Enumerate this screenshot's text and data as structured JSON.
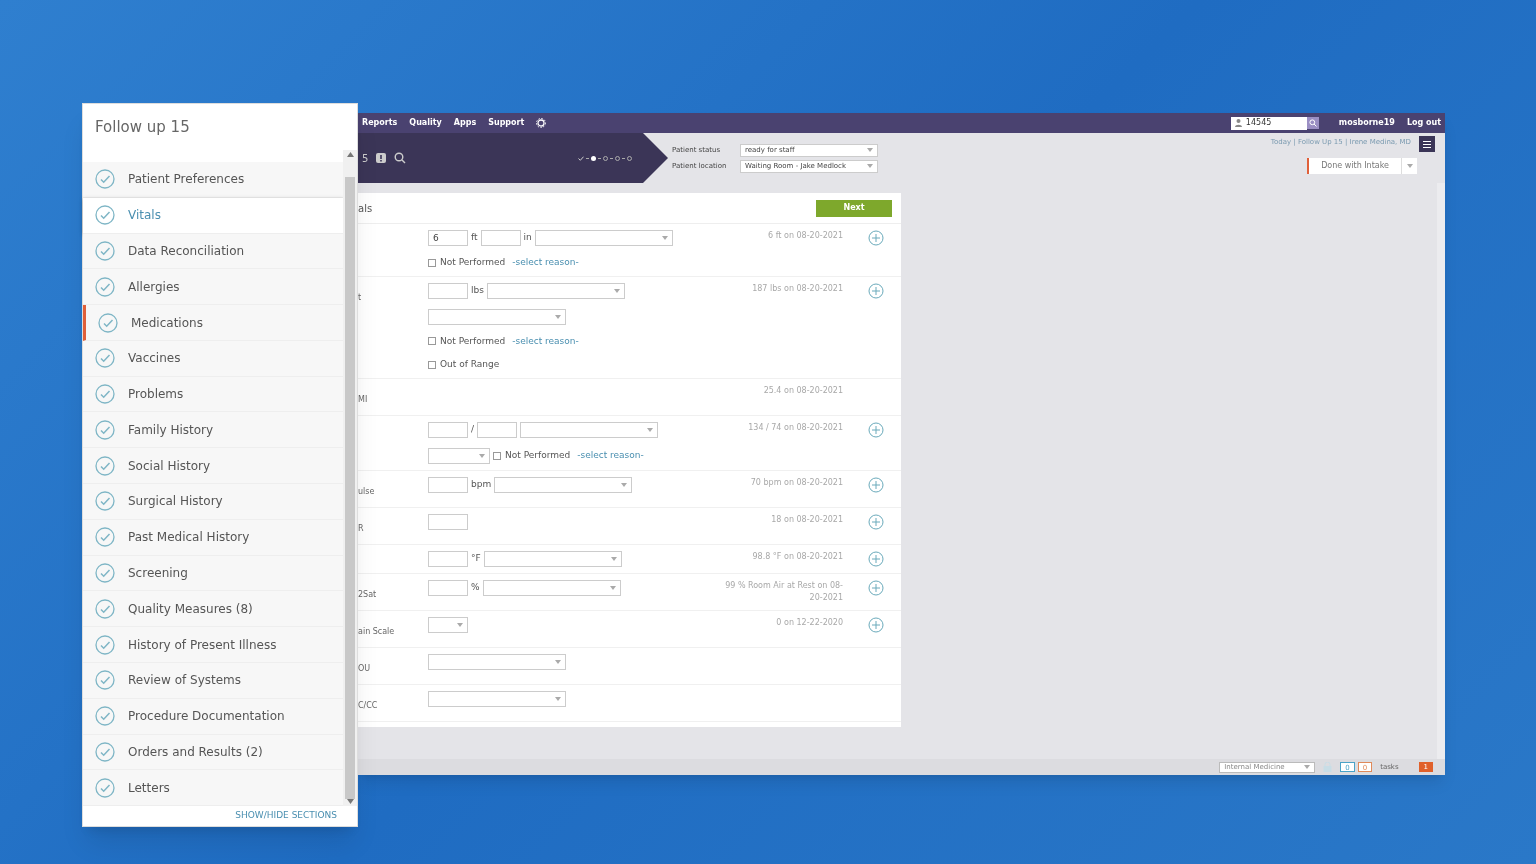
{
  "sidebar": {
    "title": "Follow up 15",
    "items": [
      {
        "label": "Patient Preferences",
        "selected": false,
        "alert": false
      },
      {
        "label": "Vitals",
        "selected": true,
        "alert": false
      },
      {
        "label": "Data Reconciliation",
        "selected": false,
        "alert": false
      },
      {
        "label": "Allergies",
        "selected": false,
        "alert": false
      },
      {
        "label": "Medications",
        "selected": false,
        "alert": true
      },
      {
        "label": "Vaccines",
        "selected": false,
        "alert": false
      },
      {
        "label": "Problems",
        "selected": false,
        "alert": false
      },
      {
        "label": "Family History",
        "selected": false,
        "alert": false
      },
      {
        "label": "Social History",
        "selected": false,
        "alert": false
      },
      {
        "label": "Surgical History",
        "selected": false,
        "alert": false
      },
      {
        "label": "Past Medical History",
        "selected": false,
        "alert": false
      },
      {
        "label": "Screening",
        "selected": false,
        "alert": false
      },
      {
        "label": "Quality Measures  (8)",
        "selected": false,
        "alert": false
      },
      {
        "label": "History of Present Illness",
        "selected": false,
        "alert": false
      },
      {
        "label": "Review of Systems",
        "selected": false,
        "alert": false
      },
      {
        "label": "Procedure Documentation",
        "selected": false,
        "alert": false
      },
      {
        "label": "Orders and Results  (2)",
        "selected": false,
        "alert": false
      },
      {
        "label": "Letters",
        "selected": false,
        "alert": false
      }
    ],
    "footer_link": "SHOW/HIDE SECTIONS"
  },
  "top_nav": {
    "menu": [
      "Reports",
      "Quality",
      "Apps",
      "Support"
    ],
    "search_value": "14545",
    "user": "mosborne19",
    "logout": "Log out"
  },
  "header": {
    "fragment": "5",
    "steps": [
      {
        "done": true,
        "current": false
      },
      {
        "done": false,
        "current": true
      },
      {
        "done": false,
        "current": false
      },
      {
        "done": false,
        "current": false
      },
      {
        "done": false,
        "current": false
      }
    ],
    "status_label": "Patient status",
    "status_value": "ready for staff",
    "location_label": "Patient location",
    "location_value": "Waiting Room - Jake Medlock",
    "breadcrumb": "Today | Follow Up 15 | Irene Medina, MD",
    "done_button": "Done with Intake"
  },
  "vitals": {
    "title": "als",
    "next": "Next",
    "rows": [
      {
        "label": "",
        "last": "6 ft on 08-20-2021",
        "add": true,
        "controls": [
          {
            "kind": "input",
            "value": "6"
          },
          {
            "kind": "unit",
            "text": "ft"
          },
          {
            "kind": "input"
          },
          {
            "kind": "unit",
            "text": "in"
          },
          {
            "kind": "select"
          },
          {
            "kind": "break"
          },
          {
            "kind": "checkbox",
            "text": "Not Performed",
            "checked": false
          },
          {
            "kind": "link",
            "text": "-select reason-"
          }
        ]
      },
      {
        "label": "t",
        "last": "187 lbs on 08-20-2021",
        "add": true,
        "controls": [
          {
            "kind": "input"
          },
          {
            "kind": "unit",
            "text": "lbs"
          },
          {
            "kind": "select"
          },
          {
            "kind": "break"
          },
          {
            "kind": "select"
          },
          {
            "kind": "break"
          },
          {
            "kind": "checkbox",
            "text": "Not Performed",
            "checked": false
          },
          {
            "kind": "link",
            "text": "-select reason-"
          },
          {
            "kind": "break"
          },
          {
            "kind": "checkbox",
            "text": "Out of Range",
            "checked": false
          }
        ]
      },
      {
        "label": "MI",
        "last": "25.4 on 08-20-2021",
        "add": false,
        "controls": []
      },
      {
        "label": "",
        "last": "134 / 74 on 08-20-2021",
        "add": true,
        "controls": [
          {
            "kind": "input"
          },
          {
            "kind": "unit",
            "text": "/"
          },
          {
            "kind": "input"
          },
          {
            "kind": "select"
          },
          {
            "kind": "break"
          },
          {
            "kind": "select_small"
          },
          {
            "kind": "checkbox",
            "text": "Not Performed",
            "checked": false
          },
          {
            "kind": "link",
            "text": "-select reason-"
          }
        ]
      },
      {
        "label": "ulse",
        "last": "70 bpm on 08-20-2021",
        "add": true,
        "controls": [
          {
            "kind": "input"
          },
          {
            "kind": "unit",
            "text": "bpm"
          },
          {
            "kind": "select"
          }
        ]
      },
      {
        "label": "R",
        "last": "18 on 08-20-2021",
        "add": true,
        "controls": [
          {
            "kind": "input"
          }
        ]
      },
      {
        "label": "",
        "last": "98.8 °F on 08-20-2021",
        "add": true,
        "controls": [
          {
            "kind": "input"
          },
          {
            "kind": "unit",
            "text": "°F"
          },
          {
            "kind": "select"
          }
        ]
      },
      {
        "label": "2Sat",
        "last": "99 % Room Air at Rest on 08-20-2021",
        "add": true,
        "controls": [
          {
            "kind": "input"
          },
          {
            "kind": "unit",
            "text": "%"
          },
          {
            "kind": "select"
          }
        ]
      },
      {
        "label": "ain Scale",
        "last": "0 on 12-22-2020",
        "add": true,
        "controls": [
          {
            "kind": "select_tiny"
          }
        ]
      },
      {
        "label": "OU",
        "add": false,
        "controls": [
          {
            "kind": "select"
          }
        ]
      },
      {
        "label": "C/CC",
        "add": false,
        "controls": [
          {
            "kind": "select"
          }
        ]
      }
    ]
  },
  "status_bar": {
    "department": "Internal Medicine",
    "counts": [
      {
        "value": "0",
        "color": "#4aa3c8"
      },
      {
        "value": "0",
        "color": "#e08a5a"
      }
    ],
    "tasks": "tasks",
    "alerts": "1"
  }
}
